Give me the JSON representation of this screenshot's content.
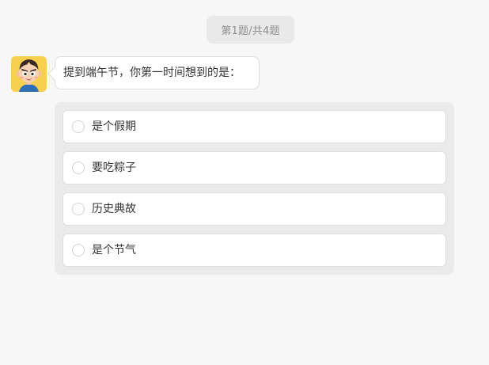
{
  "progress": {
    "text": "第1题/共4题"
  },
  "question": {
    "text": "提到端午节，你第一时间想到的是："
  },
  "options": [
    {
      "label": "是个假期"
    },
    {
      "label": "要吃粽子"
    },
    {
      "label": "历史典故"
    },
    {
      "label": "是个节气"
    }
  ],
  "colors": {
    "background": "#f7f7f7",
    "pill": "#e9e9e9",
    "panel": "#eaeaea",
    "avatar_bg": "#f7d14e"
  },
  "icons": {
    "avatar": "cartoon-boy-avatar",
    "radio": "radio-unselected-icon"
  }
}
